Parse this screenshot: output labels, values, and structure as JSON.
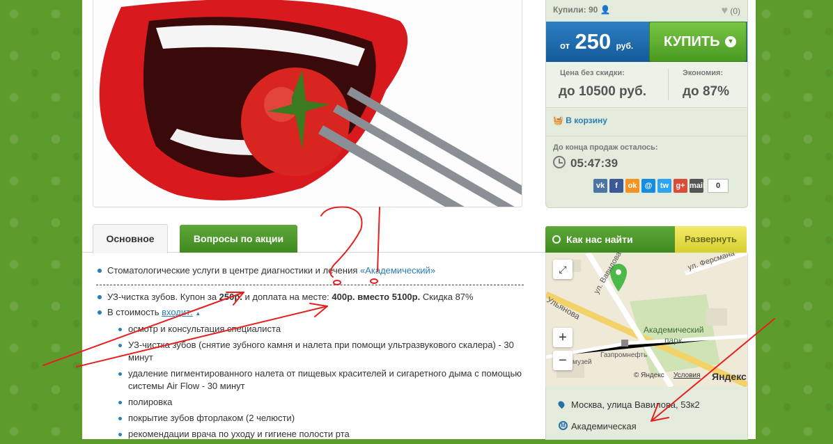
{
  "header_stats": {
    "bought_label": "Купили: 90",
    "likes": "(0)"
  },
  "price": {
    "from": "от",
    "value": "250",
    "currency": "руб."
  },
  "buy_button": {
    "label": "КУПИТЬ"
  },
  "stats": {
    "no_discount_label": "Цена без скидки:",
    "no_discount_value": "до 10500 руб.",
    "economy_label": "Экономия:",
    "economy_value": "до 87%"
  },
  "cart_label": "В корзину",
  "timer": {
    "label": "До конца продаж осталось:",
    "value": "05:47:39"
  },
  "social": {
    "buttons": [
      "vk",
      "f",
      "ok",
      "@",
      "tw",
      "g+",
      "mail"
    ],
    "count": "0",
    "colors": {
      "vk": "#4c75a3",
      "f": "#3b5998",
      "ok": "#f59321",
      "@": "#168de2",
      "tw": "#2ea3f2",
      "g+": "#dd4b39",
      "mail": "#555555"
    }
  },
  "tabs": {
    "main": "Основное",
    "questions": "Вопросы по акции"
  },
  "content": {
    "intro_text": "Стоматологические услуги в центре диагностики и лечения ",
    "intro_link": "«Академический»",
    "coupon": {
      "a": "УЗ-чистка зубов. Купон за ",
      "b": "250р.",
      "c": " и доплата на месте: ",
      "d": "400р. вместо 5100р.",
      "e": " Скидка 87%"
    },
    "includes_prefix": "В стоимость ",
    "includes_link": "входит:",
    "items": [
      "осмотр и консультация специалиста",
      "УЗ-чистка зубов (снятие зубного камня и налета при помощи ультразвукового скалера) - 30 минут",
      "удаление пигментированного налета от пищевых красителей и сигаретного дыма с помощью системы Air Flow - 30 минут",
      "полировка",
      "покрытие зубов фторлаком (2 челюсти)",
      "рекомендации врача по уходу и гигиене полости рта"
    ]
  },
  "map": {
    "title": "Как нас найти",
    "expand": "Развернуть",
    "labels": {
      "street1": "ул. Вавилова",
      "street2": "ул. Ферсмана",
      "street3": "Ульянова",
      "park": "Академический парк",
      "poi1": "Газпромнефть",
      "poi2": "музей",
      "copyright": "© Яндекс",
      "terms": "Условия",
      "brand": "Яндекс"
    },
    "controls": {
      "zoom_in": "+",
      "zoom_out": "−",
      "fullscreen": "⤢"
    }
  },
  "address": "Москва, улица Вавилова, 53к2",
  "metro": "Академическая",
  "metro_icon": "М",
  "colors": {
    "bg_green": "#5c9c2c",
    "link_blue": "#2a7db5",
    "price_blue": "#1f6db0",
    "buy_green": "#5aaa2e",
    "annotation_red": "#e52020"
  }
}
